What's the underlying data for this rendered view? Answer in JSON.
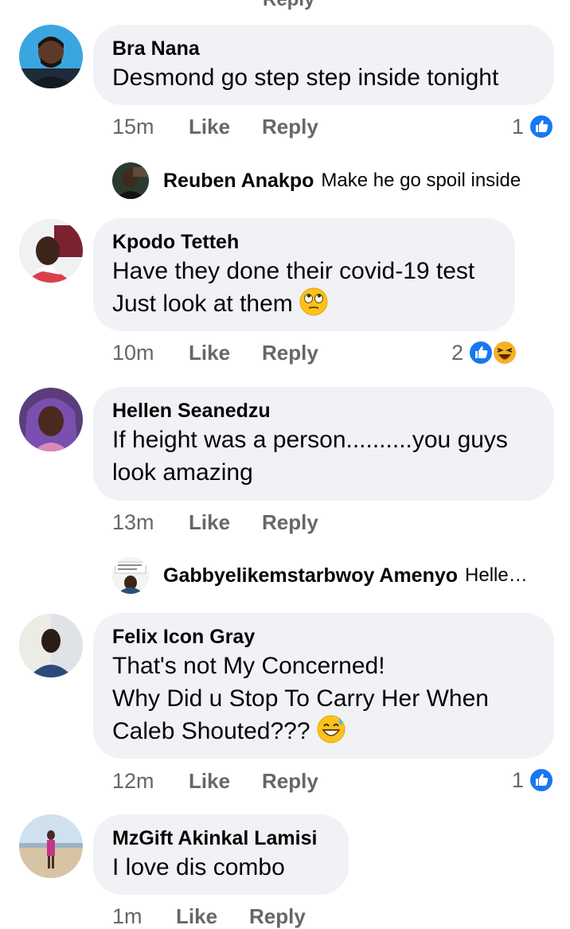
{
  "top_partial_text": "Reply",
  "comments": [
    {
      "author": "Bra Nana",
      "lines": [
        "Desmond go step step inside tonight"
      ],
      "time": "15m",
      "like_label": "Like",
      "reply_label": "Reply",
      "reaction_count": "1",
      "reactions": [
        "like-icon"
      ],
      "reply_preview": {
        "author": "Reuben Anakpo",
        "text": "Make he go spoil inside"
      }
    },
    {
      "author": "Kpodo Tetteh",
      "lines": [
        "Have they done their covid-19 test",
        "Just look at them"
      ],
      "emoji": "rolling-eyes-emoji",
      "time": "10m",
      "like_label": "Like",
      "reply_label": "Reply",
      "reaction_count": "2",
      "reactions": [
        "like-icon",
        "haha-icon"
      ]
    },
    {
      "author": "Hellen Seanedzu",
      "lines": [
        "If height was a person..........you guys",
        "look amazing"
      ],
      "time": "13m",
      "like_label": "Like",
      "reply_label": "Reply",
      "reply_preview": {
        "author": "Gabbyelikemstarbwoy Amenyo",
        "text": "Helle…"
      }
    },
    {
      "author": "Felix Icon Gray",
      "lines": [
        "That's not My Concerned!",
        "Why Did u Stop To Carry Her When",
        "Caleb Shouted???"
      ],
      "emoji": "grinning-sweat-emoji",
      "time": "12m",
      "like_label": "Like",
      "reply_label": "Reply",
      "reaction_count": "1",
      "reactions": [
        "like-icon"
      ]
    },
    {
      "author": "MzGift Akinkal Lamisi",
      "lines": [
        "I love dis combo"
      ],
      "time": "1m",
      "like_label": "Like",
      "reply_label": "Reply"
    }
  ],
  "colors": {
    "bubble": "#f0f2f5",
    "meta_text": "#65676b",
    "like_blue": "#1877f2",
    "haha_yellow": "#f7b125"
  }
}
